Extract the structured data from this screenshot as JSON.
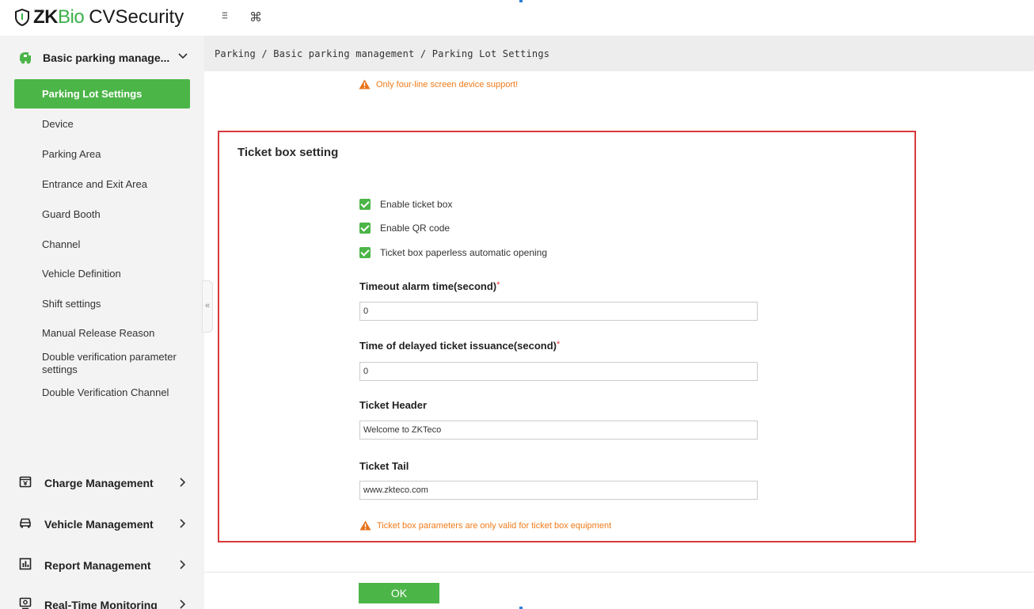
{
  "app": {
    "brand_prefix": "ZK",
    "brand_bio": "Bio",
    "brand_suffix": "CVSecurity"
  },
  "topbar": {
    "grid_icon": "⁝⁝⁝",
    "cmd_icon": "⌘"
  },
  "sidebar": {
    "module_label": "Basic parking manage...",
    "items": [
      {
        "label": "Parking Lot Settings",
        "active": true
      },
      {
        "label": "Device"
      },
      {
        "label": "Parking Area"
      },
      {
        "label": "Entrance and Exit Area"
      },
      {
        "label": "Guard Booth"
      },
      {
        "label": "Channel"
      },
      {
        "label": "Vehicle Definition"
      },
      {
        "label": "Shift settings"
      },
      {
        "label": "Manual Release Reason"
      },
      {
        "label": "Double verification parameter settings"
      },
      {
        "label": "Double Verification Channel"
      }
    ],
    "groups": [
      {
        "label": "Charge Management"
      },
      {
        "label": "Vehicle Management"
      },
      {
        "label": "Report Management"
      },
      {
        "label": "Real-Time Monitoring"
      }
    ],
    "collapse_glyph": "«"
  },
  "breadcrumb": "Parking / Basic parking management / Parking Lot Settings",
  "warnings": {
    "top": "Only four-line screen device support!",
    "bottom": "Ticket box parameters are only valid for ticket box equipment"
  },
  "ticket_box": {
    "title": "Ticket box setting",
    "checkboxes": [
      {
        "label": "Enable ticket box",
        "checked": true
      },
      {
        "label": "Enable QR code",
        "checked": true
      },
      {
        "label": "Ticket box paperless automatic opening",
        "checked": true
      }
    ],
    "fields": [
      {
        "label": "Timeout alarm time(second)",
        "required": "*",
        "value": "0"
      },
      {
        "label": "Time of delayed ticket issuance(second)",
        "required": "*",
        "value": "0"
      },
      {
        "label": "Ticket Header",
        "value": "Welcome to ZKTeco"
      },
      {
        "label": "Ticket Tail",
        "value": "www.zkteco.com"
      }
    ]
  },
  "ok_label": "OK",
  "colors": {
    "accent_green": "#4cb548",
    "highlight_red": "#d8393b",
    "warning_orange": "#f07b1a"
  }
}
